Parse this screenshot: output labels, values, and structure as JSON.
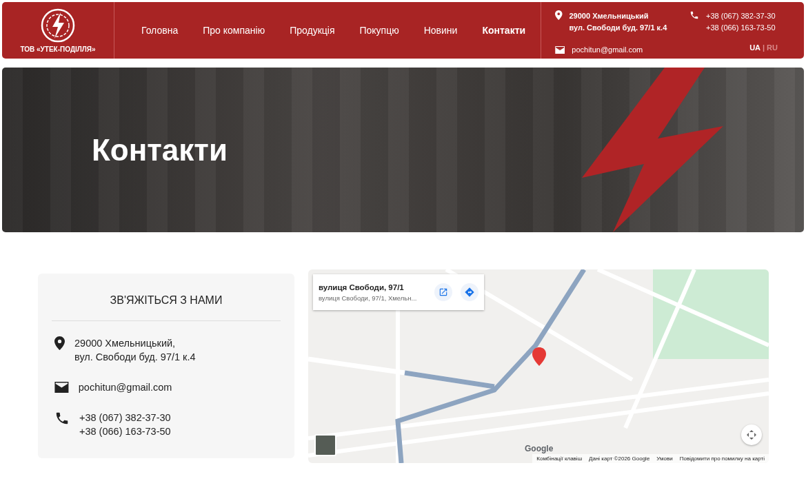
{
  "header": {
    "logo_text": "ТОВ «УТЕК-ПОДІЛЛЯ»",
    "nav": [
      {
        "label": "Головна",
        "selected": false
      },
      {
        "label": "Про компанію",
        "selected": false
      },
      {
        "label": "Продукція",
        "selected": false
      },
      {
        "label": "Покупцю",
        "selected": false
      },
      {
        "label": "Новини",
        "selected": false
      },
      {
        "label": "Контакти",
        "selected": true
      }
    ],
    "address": [
      "29000 Хмельницький",
      "вул. Свободи буд. 97/1 к.4"
    ],
    "phones": [
      "+38 (067) 382-37-30",
      "+38 (066) 163-73-50"
    ],
    "email": "pochitun@gmail.com",
    "languages": [
      {
        "label": "UA",
        "selected": true
      },
      {
        "label": "RU",
        "selected": false
      }
    ],
    "language_separator": "|"
  },
  "hero": {
    "title": "Контакти"
  },
  "contact_card": {
    "title": "ЗВ'ЯЖІТЬСЯ З НАМИ",
    "items": [
      {
        "kind": "address",
        "lines": [
          "29000 Хмельницький,",
          "вул. Свободи буд. 97/1 к.4"
        ]
      },
      {
        "kind": "email",
        "lines": [
          "pochitun@gmail.com"
        ]
      },
      {
        "kind": "phone",
        "lines": [
          "+38 (067) 382-37-30",
          "+38 (066) 163-73-50"
        ]
      }
    ]
  },
  "map": {
    "place_title": "вулиця Свободи, 97/1",
    "place_subtitle": "вулиця Свободи, 97/1, Хмельн...",
    "brand": "Google",
    "footer_links": [
      "Комбінації клавіш",
      "Дані карт ©2026 Google",
      "Умови",
      "Повідомити про помилку на карті"
    ]
  }
}
